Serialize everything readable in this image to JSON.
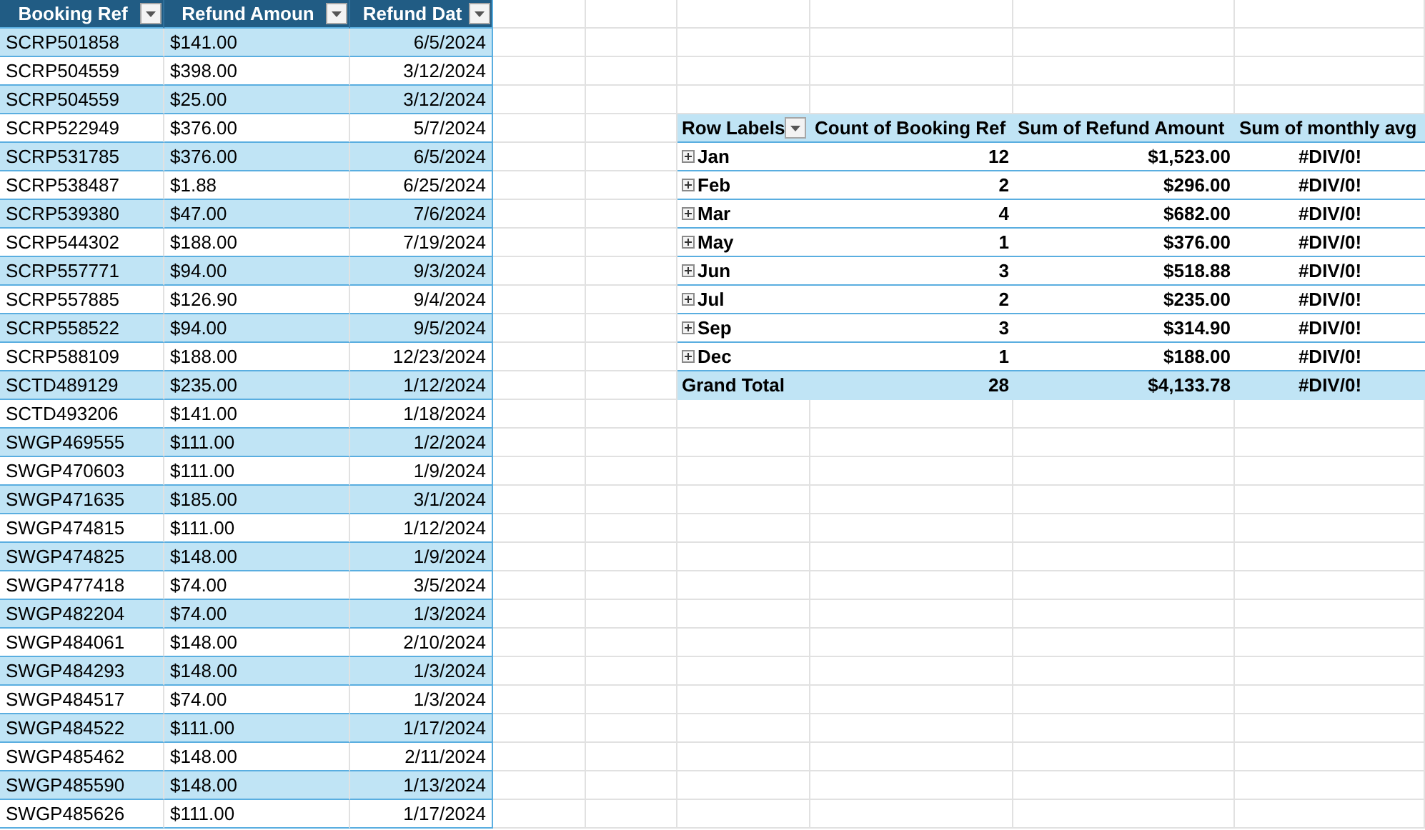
{
  "table": {
    "columns": [
      {
        "label": "Booking Ref",
        "filter": true
      },
      {
        "label": "Refund Amoun",
        "filter": true
      },
      {
        "label": "Refund Dat",
        "filter": true
      }
    ],
    "rows": [
      [
        "SCRP501858",
        "$141.00",
        "6/5/2024"
      ],
      [
        "SCRP504559",
        "$398.00",
        "3/12/2024"
      ],
      [
        "SCRP504559",
        "$25.00",
        "3/12/2024"
      ],
      [
        "SCRP522949",
        "$376.00",
        "5/7/2024"
      ],
      [
        "SCRP531785",
        "$376.00",
        "6/5/2024"
      ],
      [
        "SCRP538487",
        "$1.88",
        "6/25/2024"
      ],
      [
        "SCRP539380",
        "$47.00",
        "7/6/2024"
      ],
      [
        "SCRP544302",
        "$188.00",
        "7/19/2024"
      ],
      [
        "SCRP557771",
        "$94.00",
        "9/3/2024"
      ],
      [
        "SCRP557885",
        "$126.90",
        "9/4/2024"
      ],
      [
        "SCRP558522",
        "$94.00",
        "9/5/2024"
      ],
      [
        "SCRP588109",
        "$188.00",
        "12/23/2024"
      ],
      [
        "SCTD489129",
        "$235.00",
        "1/12/2024"
      ],
      [
        "SCTD493206",
        "$141.00",
        "1/18/2024"
      ],
      [
        "SWGP469555",
        "$111.00",
        "1/2/2024"
      ],
      [
        "SWGP470603",
        "$111.00",
        "1/9/2024"
      ],
      [
        "SWGP471635",
        "$185.00",
        "3/1/2024"
      ],
      [
        "SWGP474815",
        "$111.00",
        "1/12/2024"
      ],
      [
        "SWGP474825",
        "$148.00",
        "1/9/2024"
      ],
      [
        "SWGP477418",
        "$74.00",
        "3/5/2024"
      ],
      [
        "SWGP482204",
        "$74.00",
        "1/3/2024"
      ],
      [
        "SWGP484061",
        "$148.00",
        "2/10/2024"
      ],
      [
        "SWGP484293",
        "$148.00",
        "1/3/2024"
      ],
      [
        "SWGP484517",
        "$74.00",
        "1/3/2024"
      ],
      [
        "SWGP484522",
        "$111.00",
        "1/17/2024"
      ],
      [
        "SWGP485462",
        "$148.00",
        "2/11/2024"
      ],
      [
        "SWGP485590",
        "$148.00",
        "1/13/2024"
      ],
      [
        "SWGP485626",
        "$111.00",
        "1/17/2024"
      ]
    ]
  },
  "pivot": {
    "columns": [
      {
        "label": "Row Labels",
        "filter": true
      },
      {
        "label": "Count of Booking Ref",
        "filter": false
      },
      {
        "label": "Sum of Refund Amount",
        "filter": false
      },
      {
        "label": "Sum of monthly avg",
        "filter": false
      }
    ],
    "rows": [
      {
        "label": "Jan",
        "expanded": false,
        "count": "12",
        "sum": "$1,523.00",
        "avg": "#DIV/0!"
      },
      {
        "label": "Feb",
        "expanded": false,
        "count": "2",
        "sum": "$296.00",
        "avg": "#DIV/0!"
      },
      {
        "label": "Mar",
        "expanded": false,
        "count": "4",
        "sum": "$682.00",
        "avg": "#DIV/0!"
      },
      {
        "label": "May",
        "expanded": false,
        "count": "1",
        "sum": "$376.00",
        "avg": "#DIV/0!"
      },
      {
        "label": "Jun",
        "expanded": false,
        "count": "3",
        "sum": "$518.88",
        "avg": "#DIV/0!"
      },
      {
        "label": "Jul",
        "expanded": false,
        "count": "2",
        "sum": "$235.00",
        "avg": "#DIV/0!"
      },
      {
        "label": "Sep",
        "expanded": false,
        "count": "3",
        "sum": "$314.90",
        "avg": "#DIV/0!"
      },
      {
        "label": "Dec",
        "expanded": false,
        "count": "1",
        "sum": "$188.00",
        "avg": "#DIV/0!"
      }
    ],
    "total": {
      "label": "Grand Total",
      "count": "28",
      "sum": "$4,133.78",
      "avg": "#DIV/0!"
    }
  }
}
